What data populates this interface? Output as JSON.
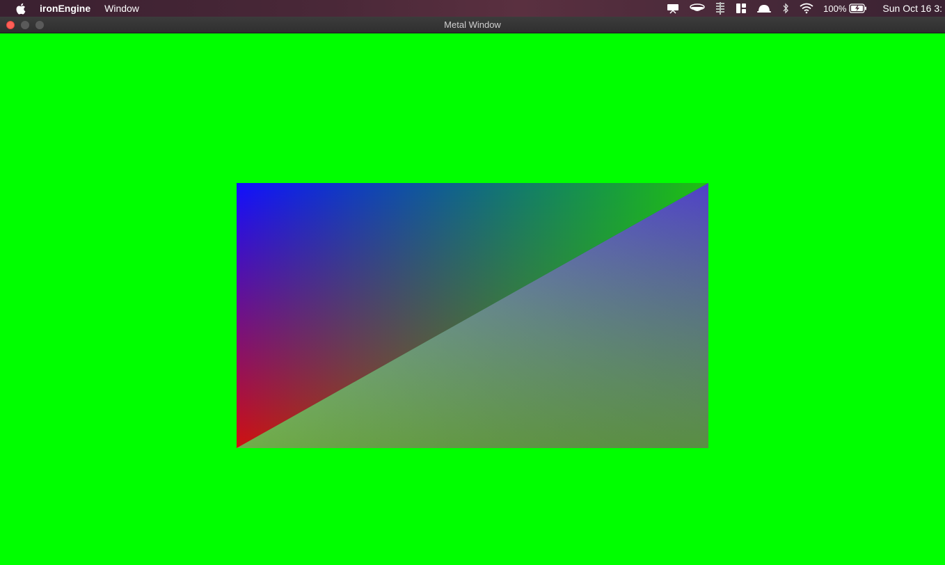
{
  "menubar": {
    "app_name": "ironEngine",
    "menus": [
      "Window"
    ],
    "battery": "100%",
    "clock": "Sun Oct 16  3:"
  },
  "window": {
    "title": "Metal Window",
    "clear_color": "#00ff00"
  },
  "icons": {
    "menubar_left": "apple-icon",
    "menubar_right": [
      "notification-icon",
      "cloud-drive-icon",
      "stack-icon",
      "layout-icon",
      "alfred-icon",
      "bluetooth-icon",
      "wifi-icon",
      "battery-icon"
    ]
  }
}
